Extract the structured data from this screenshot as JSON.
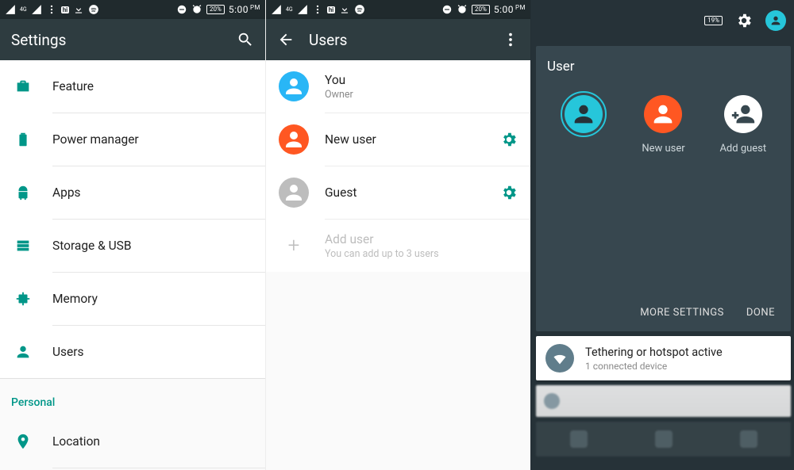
{
  "status": {
    "battery_percent": "20%",
    "battery_percent_p3": "19%",
    "time": "5:00",
    "ampm": "PM"
  },
  "panel1": {
    "title": "Settings",
    "items": [
      {
        "label": "Feature"
      },
      {
        "label": "Power manager"
      },
      {
        "label": "Apps"
      },
      {
        "label": "Storage & USB"
      },
      {
        "label": "Memory"
      },
      {
        "label": "Users"
      }
    ],
    "section_personal": "Personal",
    "personal_items": [
      {
        "label": "Location"
      }
    ]
  },
  "panel2": {
    "title": "Users",
    "users": [
      {
        "name": "You",
        "sub": "Owner",
        "color": "#29b6f6",
        "gear": false
      },
      {
        "name": "New user",
        "sub": "",
        "color": "#ff5722",
        "gear": true
      },
      {
        "name": "Guest",
        "sub": "",
        "color": "#bdbdbd",
        "gear": true
      }
    ],
    "add": {
      "title": "Add user",
      "sub": "You can add up to 3 users"
    }
  },
  "panel3": {
    "title": "User",
    "users": [
      {
        "label": "",
        "color": "#26c6da",
        "ring": true
      },
      {
        "label": "New user",
        "color": "#ff5722",
        "ring": false
      },
      {
        "label": "Add guest",
        "color": "#ffffff",
        "ring": false,
        "dark_glyph": true
      }
    ],
    "more": "MORE SETTINGS",
    "done": "DONE",
    "notif": {
      "title": "Tethering or hotspot active",
      "sub": "1 connected device"
    }
  }
}
